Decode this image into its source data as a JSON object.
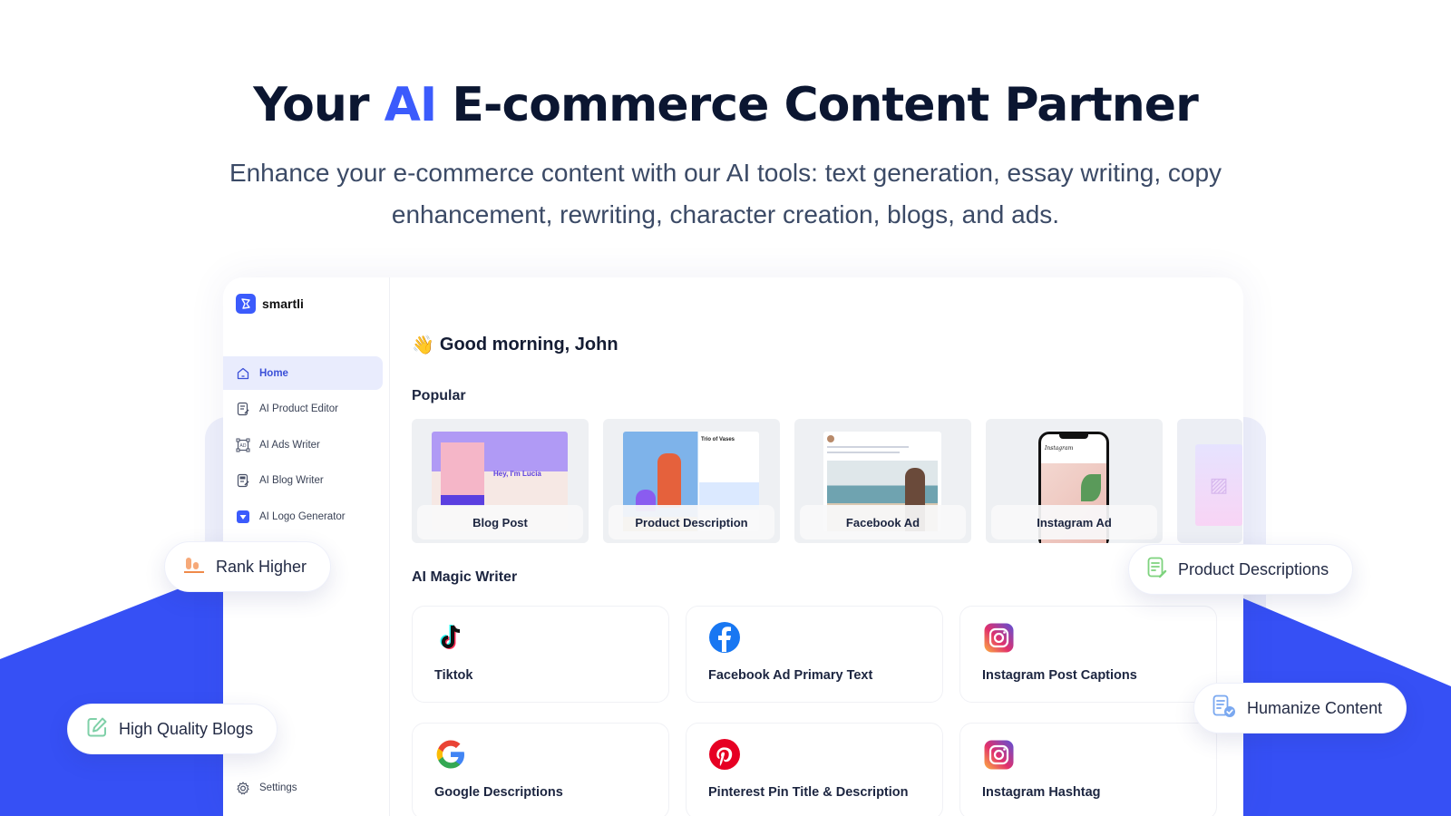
{
  "hero": {
    "title_pre": "Your ",
    "title_accent": "AI",
    "title_post": " E-commerce Content Partner",
    "subtitle": "Enhance your e-commerce content with our AI tools: text generation, essay writing, copy enhancement, rewriting, character creation, blogs, and ads."
  },
  "colors": {
    "accent": "#3b5bfc",
    "brand_blue": "#3650f5",
    "heading": "#0b1631"
  },
  "app": {
    "brand": "smartli",
    "sidebar": {
      "items": [
        {
          "label": "Home",
          "icon": "home-icon",
          "active": true
        },
        {
          "label": "AI Product Editor",
          "icon": "document-edit-icon",
          "active": false
        },
        {
          "label": "AI Ads Writer",
          "icon": "ad-frame-icon",
          "active": false
        },
        {
          "label": "AI Blog Writer",
          "icon": "blog-edit-icon",
          "active": false
        },
        {
          "label": "AI Logo Generator",
          "icon": "logo-shield-icon",
          "active": false
        }
      ],
      "settings_label": "Settings"
    },
    "greeting_emoji": "👋",
    "greeting": "Good morning, John",
    "popular_title": "Popular",
    "popular": [
      {
        "label": "Blog Post"
      },
      {
        "label": "Product Description"
      },
      {
        "label": "Facebook Ad"
      },
      {
        "label": "Instagram Ad"
      }
    ],
    "writer_title": "AI Magic Writer",
    "writers": [
      {
        "label": "Tiktok",
        "icon": "tiktok-icon"
      },
      {
        "label": "Facebook Ad Primary Text",
        "icon": "facebook-icon"
      },
      {
        "label": "Instagram Post Captions",
        "icon": "instagram-icon"
      },
      {
        "label": "Google Descriptions",
        "icon": "google-icon"
      },
      {
        "label": "Pinterest Pin Title & Description",
        "icon": "pinterest-icon"
      },
      {
        "label": "Instagram Hashtag",
        "icon": "instagram-icon"
      }
    ]
  },
  "features": {
    "rank_higher": "Rank Higher",
    "high_quality_blogs": "High Quality Blogs",
    "product_descriptions": "Product Descriptions",
    "humanize_content": "Humanize Content"
  }
}
